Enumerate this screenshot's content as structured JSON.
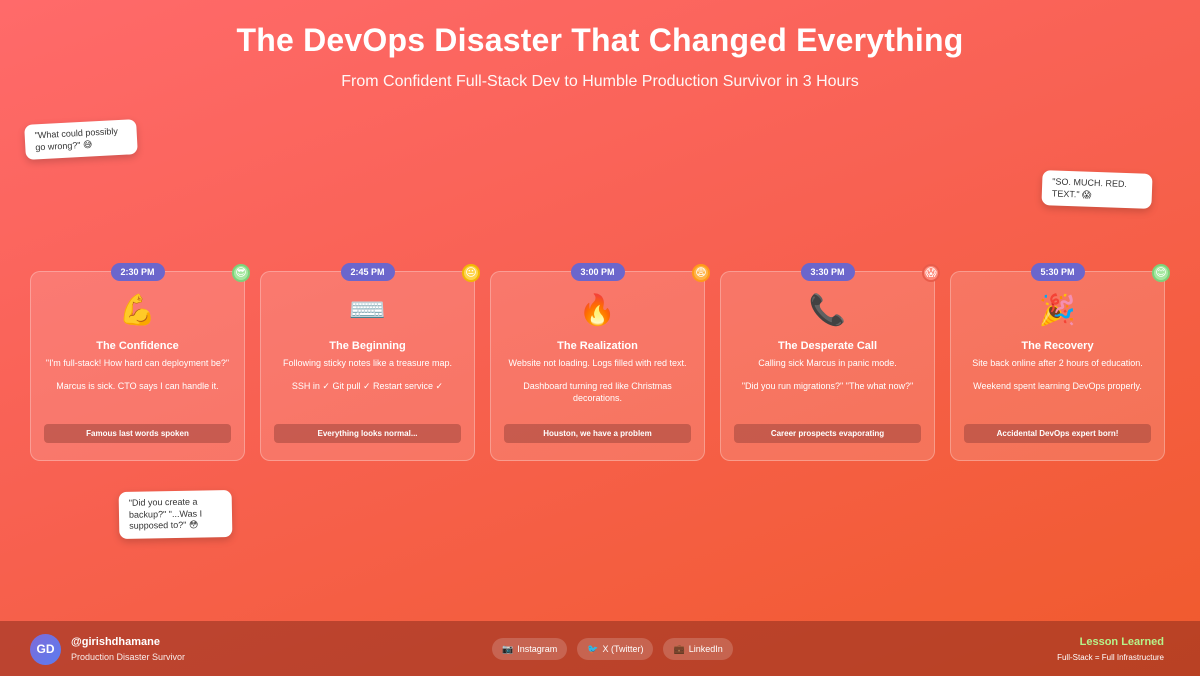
{
  "header": {
    "title": "The DevOps Disaster That Changed Everything",
    "subtitle": "From Confident Full-Stack Dev to Humble Production Survivor in 3 Hours"
  },
  "bubbles": [
    "\"What could possibly go wrong?\" 😅",
    "\"SO. MUCH. RED. TEXT.\" 😱",
    "\"Did you create a backup?\" \"...Was I supposed to?\" 😳"
  ],
  "cards": [
    {
      "time": "2:30 PM",
      "mood": "😎",
      "emoji": "💪",
      "title": "The Confidence",
      "desc1": "\"I'm full-stack! How hard can deployment be?\"",
      "desc2": "Marcus is sick. CTO says I can handle it.",
      "footer": "Famous last words spoken"
    },
    {
      "time": "2:45 PM",
      "mood": "😐",
      "emoji": "⌨️",
      "title": "The Beginning",
      "desc1": "Following sticky notes like a treasure map.",
      "desc2": "SSH in ✓ Git pull ✓ Restart service ✓",
      "footer": "Everything looks normal..."
    },
    {
      "time": "3:00 PM",
      "mood": "😨",
      "emoji": "🔥",
      "title": "The Realization",
      "desc1": "Website not loading. Logs filled with red text.",
      "desc2": "Dashboard turning red like Christmas decorations.",
      "footer": "Houston, we have a problem"
    },
    {
      "time": "3:30 PM",
      "mood": "😱",
      "emoji": "📞",
      "title": "The Desperate Call",
      "desc1": "Calling sick Marcus in panic mode.",
      "desc2": "\"Did you run migrations?\" \"The what now?\"",
      "footer": "Career prospects evaporating"
    },
    {
      "time": "5:30 PM",
      "mood": "😊",
      "emoji": "🎉",
      "title": "The Recovery",
      "desc1": "Site back online after 2 hours of education.",
      "desc2": "Weekend spent learning DevOps properly.",
      "footer": "Accidental DevOps expert born!"
    }
  ],
  "footer": {
    "avatar": "GD",
    "handle": "@girishdhamane",
    "role": "Production Disaster Survivor",
    "socials": [
      {
        "icon": "📷",
        "label": "Instagram"
      },
      {
        "icon": "🐦",
        "label": "X (Twitter)"
      },
      {
        "icon": "💼",
        "label": "LinkedIn"
      }
    ],
    "lesson_title": "Lesson Learned",
    "lesson_sub": "Full-Stack = Full Infrastructure"
  },
  "colors": {
    "time_badge": "#6b66cc",
    "lesson_accent": "#b6f28a"
  }
}
